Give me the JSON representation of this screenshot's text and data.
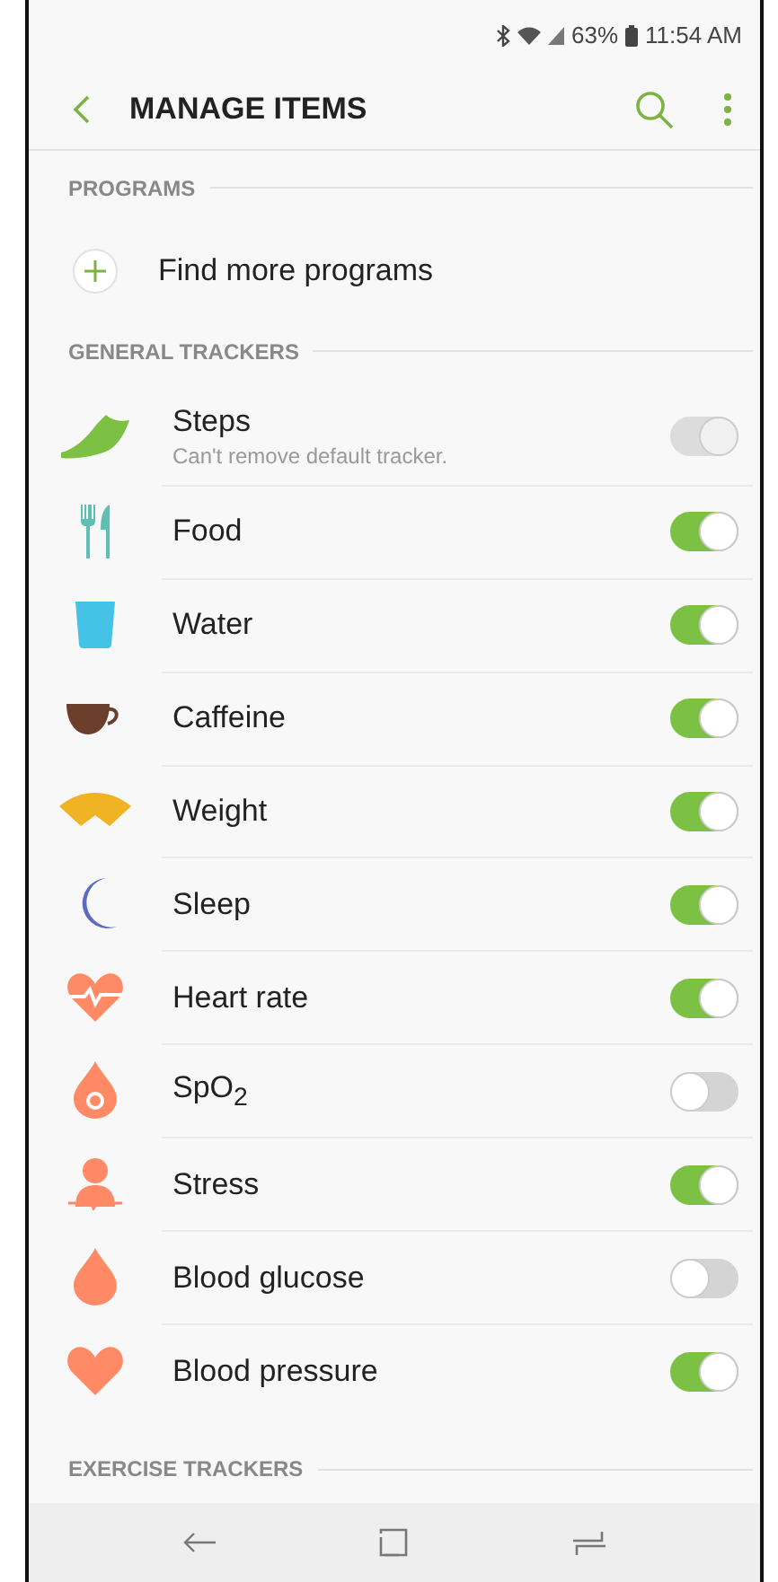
{
  "status_bar": {
    "battery": "63%",
    "time": "11:54 AM"
  },
  "header": {
    "title": "MANAGE ITEMS"
  },
  "programs": {
    "heading": "PROGRAMS",
    "action": "Find more programs"
  },
  "general_trackers": {
    "heading": "GENERAL TRACKERS",
    "items": [
      {
        "kind": "steps",
        "name": "Steps",
        "note": "Can't remove default tracker.",
        "on": true,
        "disabled": true
      },
      {
        "kind": "food",
        "name": "Food",
        "on": true,
        "disabled": false
      },
      {
        "kind": "water",
        "name": "Water",
        "on": true,
        "disabled": false
      },
      {
        "kind": "caffeine",
        "name": "Caffeine",
        "on": true,
        "disabled": false
      },
      {
        "kind": "weight",
        "name": "Weight",
        "on": true,
        "disabled": false
      },
      {
        "kind": "sleep",
        "name": "Sleep",
        "on": true,
        "disabled": false
      },
      {
        "kind": "heart",
        "name": "Heart rate",
        "on": true,
        "disabled": false
      },
      {
        "kind": "spo2",
        "name": "SpO$_{2}$",
        "on": false,
        "disabled": false
      },
      {
        "kind": "stress",
        "name": "Stress",
        "on": true,
        "disabled": false
      },
      {
        "kind": "glucose",
        "name": "Blood glucose",
        "on": false,
        "disabled": false
      },
      {
        "kind": "pressure",
        "name": "Blood pressure",
        "on": true,
        "disabled": false
      }
    ]
  },
  "exercise_trackers": {
    "heading": "EXERCISE TRACKERS"
  }
}
